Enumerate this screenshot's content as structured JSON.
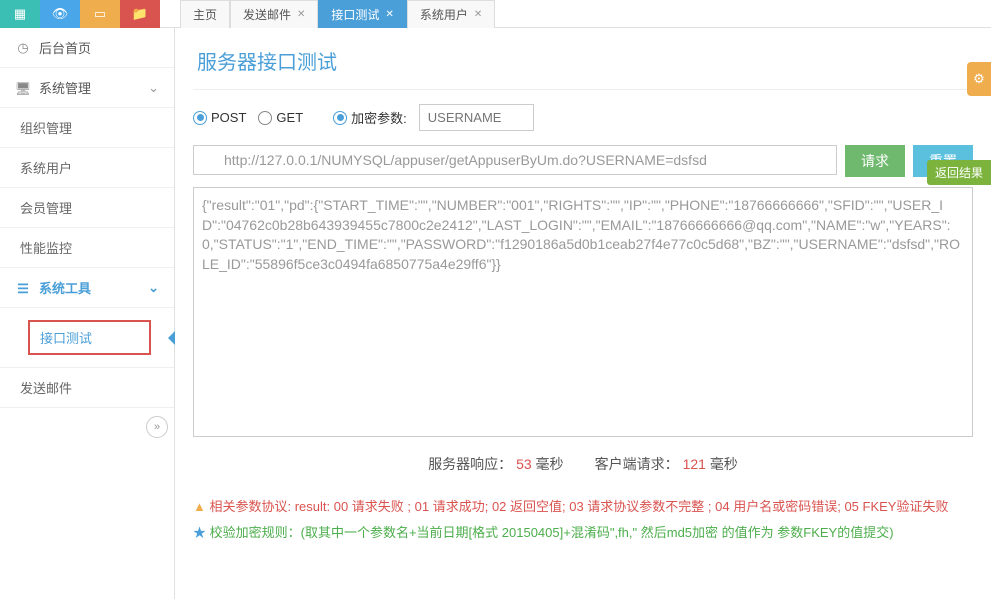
{
  "toolbar": {
    "icons": [
      "grid-icon",
      "eye-icon",
      "book-icon",
      "folder-icon"
    ]
  },
  "tabs": [
    {
      "label": "主页",
      "closable": false,
      "active": false
    },
    {
      "label": "发送邮件",
      "closable": true,
      "active": false
    },
    {
      "label": "接口测试",
      "closable": true,
      "active": true
    },
    {
      "label": "系统用户",
      "closable": true,
      "active": false
    }
  ],
  "sidebar": {
    "home": "后台首页",
    "sys_group": "系统管理",
    "sys_items": [
      "组织管理",
      "系统用户",
      "会员管理",
      "性能监控"
    ],
    "tools_group": "系统工具",
    "tool_items": [
      "接口测试",
      "发送邮件"
    ]
  },
  "page": {
    "title": "服务器接口测试",
    "post_label": "POST",
    "get_label": "GET",
    "encrypt_label": "加密参数:",
    "encrypt_placeholder": "USERNAME",
    "url": "http://127.0.0.1/NUMYSQL/appuser/getAppuserByUm.do?USERNAME=dsfsd",
    "request_btn": "请求",
    "reset_btn": "重置",
    "result_tag": "返回结果",
    "result": "{\"result\":\"01\",\"pd\":{\"START_TIME\":\"\",\"NUMBER\":\"001\",\"RIGHTS\":\"\",\"IP\":\"\",\"PHONE\":\"18766666666\",\"SFID\":\"\",\"USER_ID\":\"04762c0b28b643939455c7800c2e2412\",\"LAST_LOGIN\":\"\",\"EMAIL\":\"18766666666@qq.com\",\"NAME\":\"w\",\"YEARS\":0,\"STATUS\":\"1\",\"END_TIME\":\"\",\"PASSWORD\":\"f1290186a5d0b1ceab27f4e77c0c5d68\",\"BZ\":\"\",\"USERNAME\":\"dsfsd\",\"ROLE_ID\":\"55896f5ce3c0494fa6850775a4e29ff6\"}}",
    "timing_server_label": "服务器响应：",
    "timing_server_value": "53",
    "timing_client_label": "客户端请求：",
    "timing_client_value": "121",
    "timing_unit": "毫秒",
    "note_warn": "相关参数协议: result: 00 请求失败 ; 01 请求成功; 02 返回空值; 03 请求协议参数不完整 ; 04 用户名或密码错误; 05 FKEY验证失败",
    "note_star": "校验加密规则：(取其中一个参数名+当前日期[格式 20150405]+混淆码\",fh,\" 然后md5加密 的值作为 参数FKEY的值提交)"
  }
}
